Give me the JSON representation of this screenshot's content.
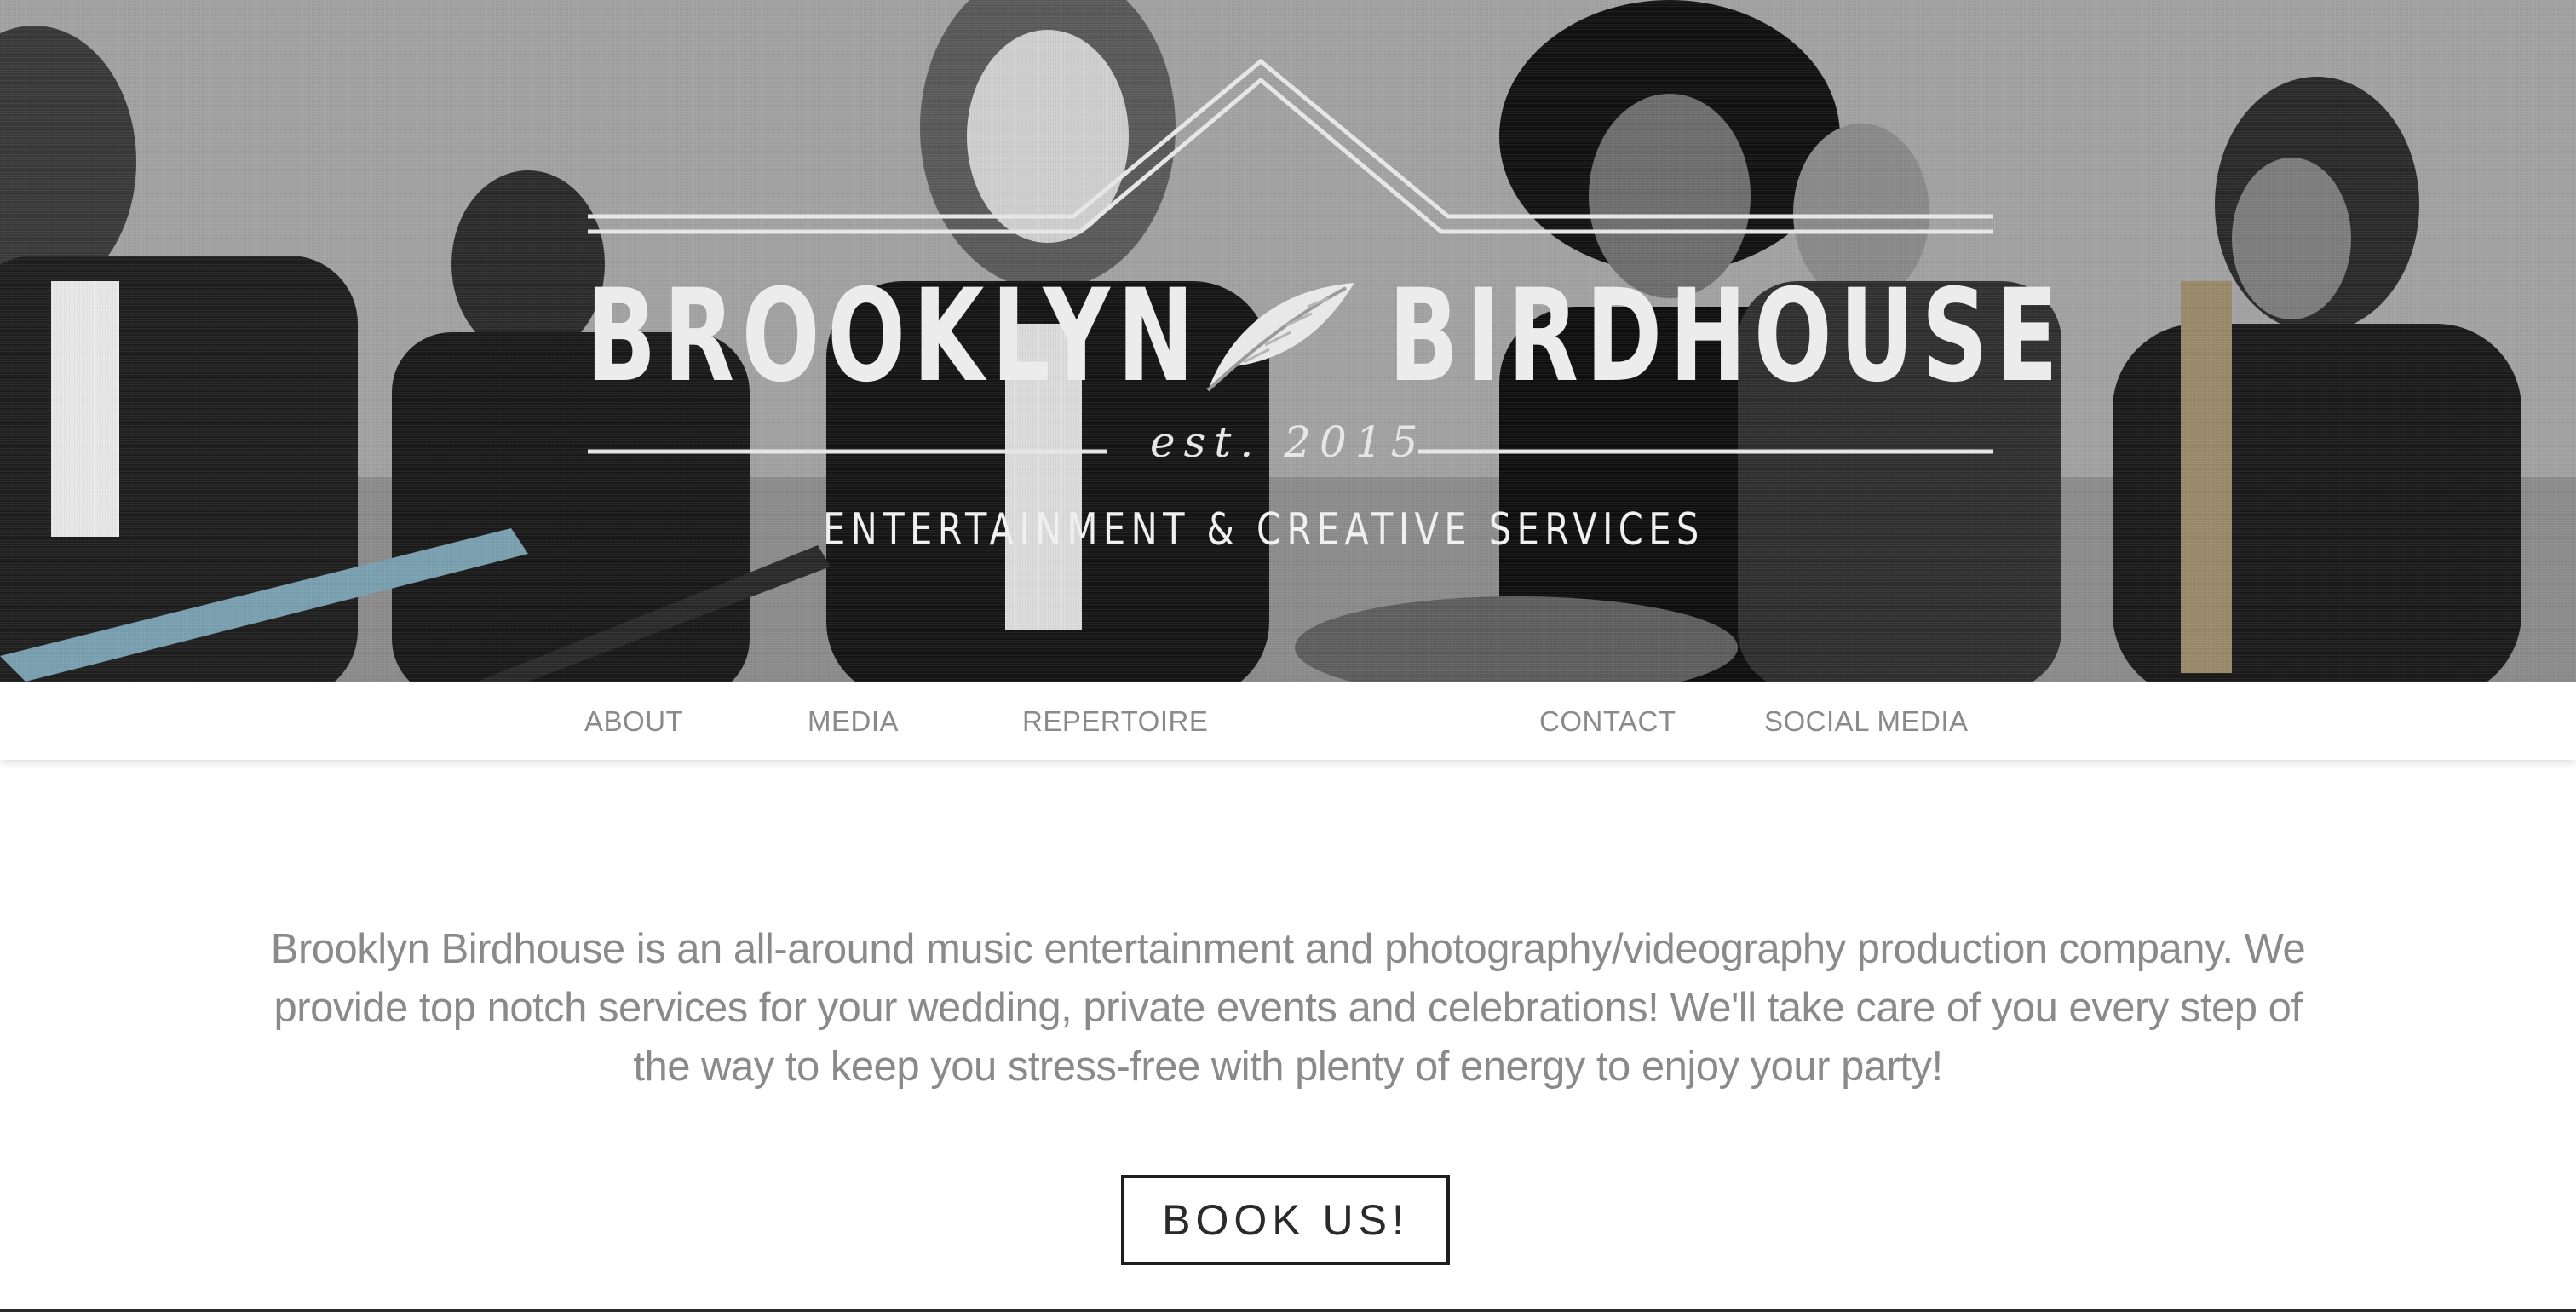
{
  "hero": {
    "brand_left": "BROOKLYN",
    "brand_right": "BIRDHOUSE",
    "established": "est. 2015",
    "tagline": "ENTERTAINMENT  &  CREATIVE SERVICES"
  },
  "nav": {
    "items": [
      {
        "label": "ABOUT"
      },
      {
        "label": "MEDIA"
      },
      {
        "label": "REPERTOIRE"
      },
      {
        "label": "CONTACT"
      },
      {
        "label": "SOCIAL MEDIA"
      }
    ]
  },
  "main": {
    "intro": "Brooklyn Birdhouse is an all-around music entertainment and photography/videography production company. We provide top notch services for your wedding, private events and celebrations! We'll take care of you every step of the way to keep you stress-free with plenty of energy to enjoy your party!",
    "book_button": "BOOK US!"
  },
  "colors": {
    "nav_text": "#8a8a8a",
    "body_text": "#8a8a8a",
    "button_border": "#1e1e1e",
    "logo": "#ececec"
  },
  "icons": [
    "feather-icon",
    "roof-line-icon"
  ]
}
